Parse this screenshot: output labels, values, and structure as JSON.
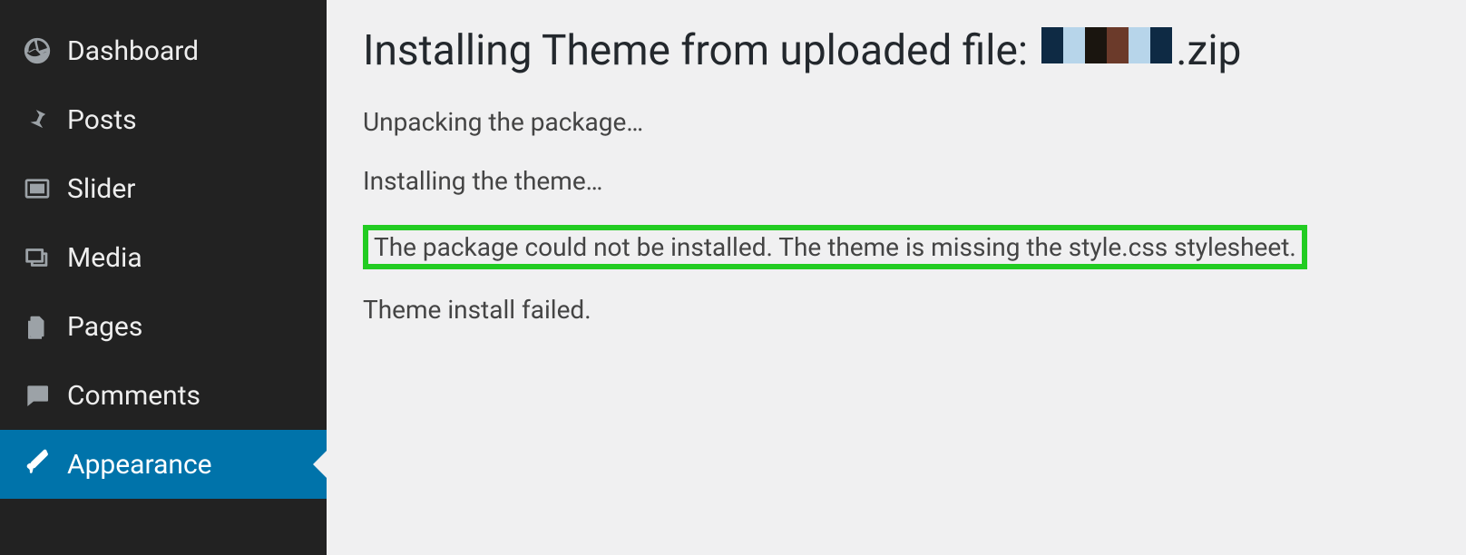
{
  "sidebar": {
    "items": [
      {
        "label": "Dashboard",
        "icon": "dashboard-icon",
        "active": false
      },
      {
        "label": "Posts",
        "icon": "pin-icon",
        "active": false
      },
      {
        "label": "Slider",
        "icon": "slider-icon",
        "active": false
      },
      {
        "label": "Media",
        "icon": "media-icon",
        "active": false
      },
      {
        "label": "Pages",
        "icon": "pages-icon",
        "active": false
      },
      {
        "label": "Comments",
        "icon": "comments-icon",
        "active": false
      },
      {
        "label": "Appearance",
        "icon": "brush-icon",
        "active": true
      }
    ]
  },
  "main": {
    "title_prefix": "Installing Theme from uploaded file: ",
    "title_suffix": ".zip",
    "redacted_colors": [
      "#0e2a44",
      "#b7d5ea",
      "#1a150f",
      "#6b3a2a",
      "#b7d5ea",
      "#0e2a44"
    ],
    "lines": {
      "unpacking": "Unpacking the package…",
      "installing": "Installing the theme…",
      "error": "The package could not be installed. The theme is missing the style.css stylesheet.",
      "failed": "Theme install failed."
    }
  }
}
